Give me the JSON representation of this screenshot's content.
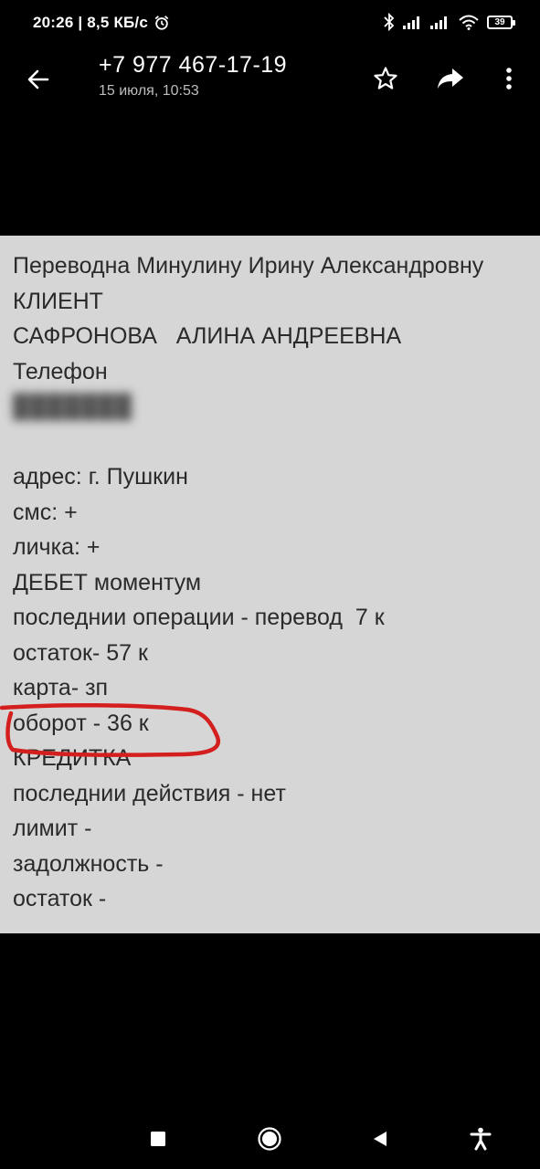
{
  "status_bar": {
    "time_speed": "20:26 | 8,5 КБ/с",
    "battery": "39",
    "icons": [
      "alarm-icon",
      "bluetooth-icon",
      "signal-icon",
      "signal-icon",
      "wifi-icon",
      "battery-icon"
    ]
  },
  "header": {
    "sender": "+7 977 467-17-19",
    "datetime": "15 июля, 10:53",
    "icons": [
      "back-arrow-icon",
      "star-icon",
      "share-icon",
      "more-vert-icon"
    ]
  },
  "message_image": {
    "lines": [
      "Переводна Минулину Ирину Александровну",
      "КЛИЕНТ",
      "САФРОНОВА   АЛИНА АНДРЕЕВНА",
      "Телефон",
      "",
      "",
      "адрес: г. Пушкин",
      "смс: +",
      "личка: +",
      "ДЕБЕТ моментум",
      "последнии операции - перевод  7 к",
      "остаток- 57 к",
      "карта- зп",
      "оборот - 36 к",
      "КРЕДИТКА",
      "последнии действия - нет",
      "лимит -",
      "задолжность -",
      "остаток -"
    ],
    "highlight_color": "#d41f1f"
  },
  "nav_bar": {
    "icons": [
      "recent-apps-icon",
      "home-icon",
      "back-triangle-icon",
      "accessibility-icon"
    ]
  }
}
